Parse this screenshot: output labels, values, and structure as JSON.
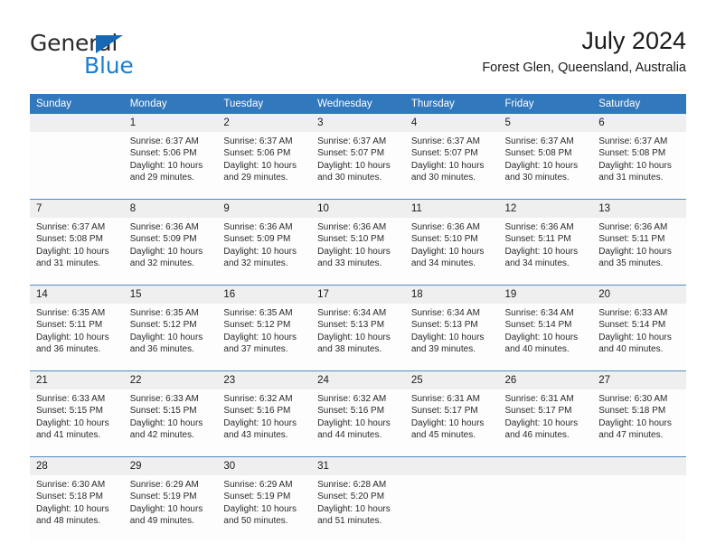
{
  "brand": {
    "name_part1": "General",
    "name_part2": "Blue",
    "triangle_color": "#1667b4",
    "blue_color": "#1a7fd4"
  },
  "header": {
    "title": "July 2024",
    "subtitle": "Forest Glen, Queensland, Australia"
  },
  "theme": {
    "header_bg": "#3278bd",
    "header_text": "#ffffff",
    "daynum_bg": "#efefef",
    "cell_bg": "#fdfdfd",
    "separator": "#3278bd"
  },
  "weekdays": [
    "Sunday",
    "Monday",
    "Tuesday",
    "Wednesday",
    "Thursday",
    "Friday",
    "Saturday"
  ],
  "weeks": [
    [
      {
        "day": "",
        "sunrise": "",
        "sunset": "",
        "daylight_line1": "",
        "daylight_line2": ""
      },
      {
        "day": "1",
        "sunrise": "Sunrise: 6:37 AM",
        "sunset": "Sunset: 5:06 PM",
        "daylight_line1": "Daylight: 10 hours",
        "daylight_line2": "and 29 minutes."
      },
      {
        "day": "2",
        "sunrise": "Sunrise: 6:37 AM",
        "sunset": "Sunset: 5:06 PM",
        "daylight_line1": "Daylight: 10 hours",
        "daylight_line2": "and 29 minutes."
      },
      {
        "day": "3",
        "sunrise": "Sunrise: 6:37 AM",
        "sunset": "Sunset: 5:07 PM",
        "daylight_line1": "Daylight: 10 hours",
        "daylight_line2": "and 30 minutes."
      },
      {
        "day": "4",
        "sunrise": "Sunrise: 6:37 AM",
        "sunset": "Sunset: 5:07 PM",
        "daylight_line1": "Daylight: 10 hours",
        "daylight_line2": "and 30 minutes."
      },
      {
        "day": "5",
        "sunrise": "Sunrise: 6:37 AM",
        "sunset": "Sunset: 5:08 PM",
        "daylight_line1": "Daylight: 10 hours",
        "daylight_line2": "and 30 minutes."
      },
      {
        "day": "6",
        "sunrise": "Sunrise: 6:37 AM",
        "sunset": "Sunset: 5:08 PM",
        "daylight_line1": "Daylight: 10 hours",
        "daylight_line2": "and 31 minutes."
      }
    ],
    [
      {
        "day": "7",
        "sunrise": "Sunrise: 6:37 AM",
        "sunset": "Sunset: 5:08 PM",
        "daylight_line1": "Daylight: 10 hours",
        "daylight_line2": "and 31 minutes."
      },
      {
        "day": "8",
        "sunrise": "Sunrise: 6:36 AM",
        "sunset": "Sunset: 5:09 PM",
        "daylight_line1": "Daylight: 10 hours",
        "daylight_line2": "and 32 minutes."
      },
      {
        "day": "9",
        "sunrise": "Sunrise: 6:36 AM",
        "sunset": "Sunset: 5:09 PM",
        "daylight_line1": "Daylight: 10 hours",
        "daylight_line2": "and 32 minutes."
      },
      {
        "day": "10",
        "sunrise": "Sunrise: 6:36 AM",
        "sunset": "Sunset: 5:10 PM",
        "daylight_line1": "Daylight: 10 hours",
        "daylight_line2": "and 33 minutes."
      },
      {
        "day": "11",
        "sunrise": "Sunrise: 6:36 AM",
        "sunset": "Sunset: 5:10 PM",
        "daylight_line1": "Daylight: 10 hours",
        "daylight_line2": "and 34 minutes."
      },
      {
        "day": "12",
        "sunrise": "Sunrise: 6:36 AM",
        "sunset": "Sunset: 5:11 PM",
        "daylight_line1": "Daylight: 10 hours",
        "daylight_line2": "and 34 minutes."
      },
      {
        "day": "13",
        "sunrise": "Sunrise: 6:36 AM",
        "sunset": "Sunset: 5:11 PM",
        "daylight_line1": "Daylight: 10 hours",
        "daylight_line2": "and 35 minutes."
      }
    ],
    [
      {
        "day": "14",
        "sunrise": "Sunrise: 6:35 AM",
        "sunset": "Sunset: 5:11 PM",
        "daylight_line1": "Daylight: 10 hours",
        "daylight_line2": "and 36 minutes."
      },
      {
        "day": "15",
        "sunrise": "Sunrise: 6:35 AM",
        "sunset": "Sunset: 5:12 PM",
        "daylight_line1": "Daylight: 10 hours",
        "daylight_line2": "and 36 minutes."
      },
      {
        "day": "16",
        "sunrise": "Sunrise: 6:35 AM",
        "sunset": "Sunset: 5:12 PM",
        "daylight_line1": "Daylight: 10 hours",
        "daylight_line2": "and 37 minutes."
      },
      {
        "day": "17",
        "sunrise": "Sunrise: 6:34 AM",
        "sunset": "Sunset: 5:13 PM",
        "daylight_line1": "Daylight: 10 hours",
        "daylight_line2": "and 38 minutes."
      },
      {
        "day": "18",
        "sunrise": "Sunrise: 6:34 AM",
        "sunset": "Sunset: 5:13 PM",
        "daylight_line1": "Daylight: 10 hours",
        "daylight_line2": "and 39 minutes."
      },
      {
        "day": "19",
        "sunrise": "Sunrise: 6:34 AM",
        "sunset": "Sunset: 5:14 PM",
        "daylight_line1": "Daylight: 10 hours",
        "daylight_line2": "and 40 minutes."
      },
      {
        "day": "20",
        "sunrise": "Sunrise: 6:33 AM",
        "sunset": "Sunset: 5:14 PM",
        "daylight_line1": "Daylight: 10 hours",
        "daylight_line2": "and 40 minutes."
      }
    ],
    [
      {
        "day": "21",
        "sunrise": "Sunrise: 6:33 AM",
        "sunset": "Sunset: 5:15 PM",
        "daylight_line1": "Daylight: 10 hours",
        "daylight_line2": "and 41 minutes."
      },
      {
        "day": "22",
        "sunrise": "Sunrise: 6:33 AM",
        "sunset": "Sunset: 5:15 PM",
        "daylight_line1": "Daylight: 10 hours",
        "daylight_line2": "and 42 minutes."
      },
      {
        "day": "23",
        "sunrise": "Sunrise: 6:32 AM",
        "sunset": "Sunset: 5:16 PM",
        "daylight_line1": "Daylight: 10 hours",
        "daylight_line2": "and 43 minutes."
      },
      {
        "day": "24",
        "sunrise": "Sunrise: 6:32 AM",
        "sunset": "Sunset: 5:16 PM",
        "daylight_line1": "Daylight: 10 hours",
        "daylight_line2": "and 44 minutes."
      },
      {
        "day": "25",
        "sunrise": "Sunrise: 6:31 AM",
        "sunset": "Sunset: 5:17 PM",
        "daylight_line1": "Daylight: 10 hours",
        "daylight_line2": "and 45 minutes."
      },
      {
        "day": "26",
        "sunrise": "Sunrise: 6:31 AM",
        "sunset": "Sunset: 5:17 PM",
        "daylight_line1": "Daylight: 10 hours",
        "daylight_line2": "and 46 minutes."
      },
      {
        "day": "27",
        "sunrise": "Sunrise: 6:30 AM",
        "sunset": "Sunset: 5:18 PM",
        "daylight_line1": "Daylight: 10 hours",
        "daylight_line2": "and 47 minutes."
      }
    ],
    [
      {
        "day": "28",
        "sunrise": "Sunrise: 6:30 AM",
        "sunset": "Sunset: 5:18 PM",
        "daylight_line1": "Daylight: 10 hours",
        "daylight_line2": "and 48 minutes."
      },
      {
        "day": "29",
        "sunrise": "Sunrise: 6:29 AM",
        "sunset": "Sunset: 5:19 PM",
        "daylight_line1": "Daylight: 10 hours",
        "daylight_line2": "and 49 minutes."
      },
      {
        "day": "30",
        "sunrise": "Sunrise: 6:29 AM",
        "sunset": "Sunset: 5:19 PM",
        "daylight_line1": "Daylight: 10 hours",
        "daylight_line2": "and 50 minutes."
      },
      {
        "day": "31",
        "sunrise": "Sunrise: 6:28 AM",
        "sunset": "Sunset: 5:20 PM",
        "daylight_line1": "Daylight: 10 hours",
        "daylight_line2": "and 51 minutes."
      },
      {
        "day": "",
        "sunrise": "",
        "sunset": "",
        "daylight_line1": "",
        "daylight_line2": ""
      },
      {
        "day": "",
        "sunrise": "",
        "sunset": "",
        "daylight_line1": "",
        "daylight_line2": ""
      },
      {
        "day": "",
        "sunrise": "",
        "sunset": "",
        "daylight_line1": "",
        "daylight_line2": ""
      }
    ]
  ]
}
